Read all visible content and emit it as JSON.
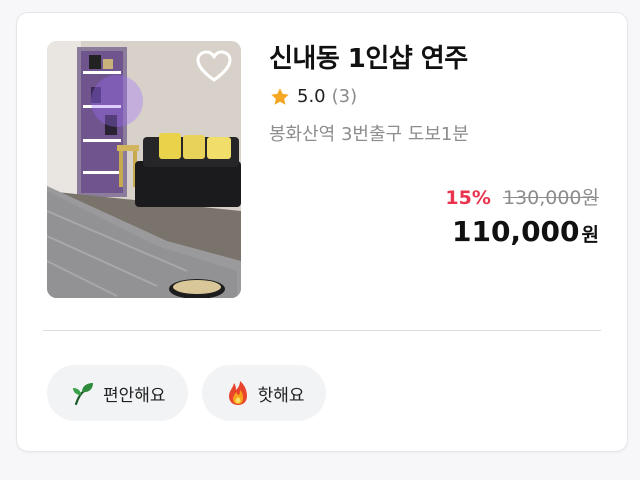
{
  "listing": {
    "title": "신내동 1인샵 연주",
    "rating": {
      "score": "5.0",
      "count": "(3)"
    },
    "location": "봉화산역 3번출구 도보1분",
    "price": {
      "discount": "15%",
      "original": "130,000원",
      "final": "110,000",
      "unit": "원"
    },
    "favorite_icon": "heart-outline-icon",
    "rating_icon": "star-icon"
  },
  "tags": [
    {
      "label": "편안해요",
      "icon": "leaf-icon"
    },
    {
      "label": "핫해요",
      "icon": "fire-icon"
    }
  ],
  "colors": {
    "discount": "#e8344e",
    "star": "#f5a623",
    "muted_text": "#8d8d8d",
    "tag_background": "#f2f3f5"
  }
}
